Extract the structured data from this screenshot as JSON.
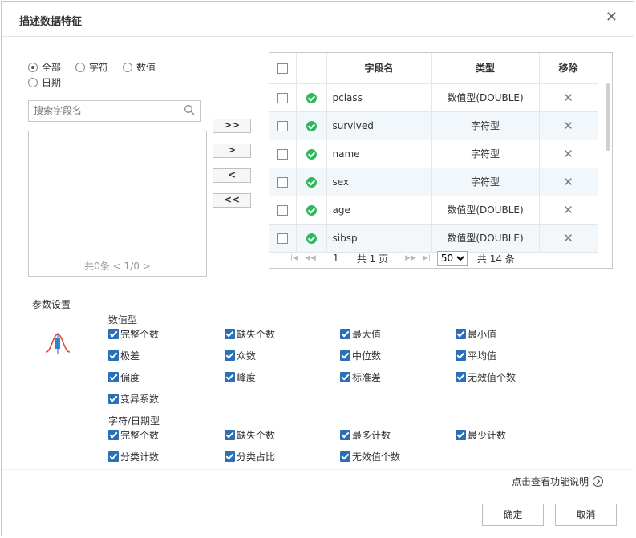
{
  "dialog": {
    "title": "描述数据特征",
    "close_icon": "close-icon"
  },
  "filters": {
    "all": "全部",
    "string": "字符",
    "numeric": "数值",
    "date": "日期",
    "selected": "all"
  },
  "search": {
    "placeholder": "搜索字段名"
  },
  "left_list": {
    "pager": "共0条  <  1/0  >"
  },
  "move_buttons": {
    "add_all": ">>",
    "add": ">",
    "remove": "<",
    "remove_all": "<<"
  },
  "grid": {
    "headers": {
      "name": "字段名",
      "type": "类型",
      "remove": "移除"
    },
    "rows": [
      {
        "name": "pclass",
        "type": "数值型(DOUBLE)"
      },
      {
        "name": "survived",
        "type": "字符型"
      },
      {
        "name": "name",
        "type": "字符型"
      },
      {
        "name": "sex",
        "type": "字符型"
      },
      {
        "name": "age",
        "type": "数值型(DOUBLE)"
      },
      {
        "name": "sibsp",
        "type": "数值型(DOUBLE)"
      }
    ],
    "pager": {
      "page": "1",
      "total_pages": "共 1 页",
      "page_size": "50",
      "total": "共 14 条"
    }
  },
  "params": {
    "section_title": "参数设置",
    "numeric_group": "数值型",
    "numeric_items": [
      "完整个数",
      "缺失个数",
      "最大值",
      "最小值",
      "极差",
      "众数",
      "中位数",
      "平均值",
      "偏度",
      "峰度",
      "标准差",
      "无效值个数",
      "变异系数"
    ],
    "string_group": "字符/日期型",
    "string_items": [
      "完整个数",
      "缺失个数",
      "最多计数",
      "最少计数",
      "分类计数",
      "分类占比",
      "无效值个数"
    ]
  },
  "footer": {
    "help": "点击查看功能说明",
    "ok": "确定",
    "cancel": "取消"
  },
  "colors": {
    "checkbox": "#2a6fb8",
    "status_ok": "#2eb85c",
    "row_alt": "#f2f7fc"
  }
}
